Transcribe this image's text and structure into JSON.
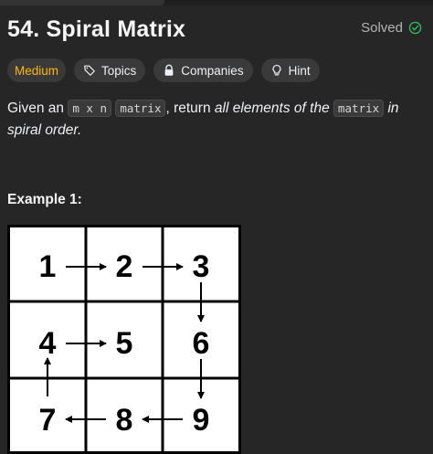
{
  "problem": {
    "title": "54. Spiral Matrix",
    "status": "Solved",
    "tags": {
      "difficulty": "Medium",
      "topics": "Topics",
      "companies": "Companies",
      "hint": "Hint"
    },
    "description": {
      "part1": "Given an",
      "code_dims": "m x n",
      "code_matrix": "matrix",
      "part2": ", return",
      "emphasis": "all elements of the",
      "code_matrix2": "matrix",
      "part3": "in spiral order."
    },
    "example_title": "Example 1:",
    "matrix_cells": [
      "1",
      "2",
      "3",
      "4",
      "5",
      "6",
      "7",
      "8",
      "9"
    ]
  },
  "colors": {
    "difficulty": "#ffb800",
    "solved_check": "#2cbb5d"
  }
}
